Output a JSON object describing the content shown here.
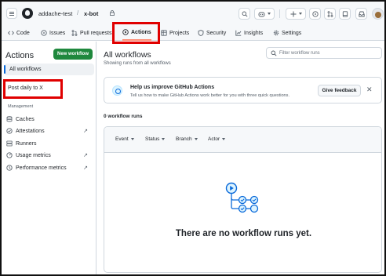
{
  "header": {
    "owner": "addache-test",
    "separator": "/",
    "repo": "x-bot"
  },
  "tabs": [
    {
      "label": "Code",
      "icon": "code-icon"
    },
    {
      "label": "Issues",
      "icon": "issue-icon"
    },
    {
      "label": "Pull requests",
      "icon": "pull-request-icon"
    },
    {
      "label": "Actions",
      "icon": "play-icon",
      "active": true
    },
    {
      "label": "Projects",
      "icon": "table-icon"
    },
    {
      "label": "Security",
      "icon": "shield-icon"
    },
    {
      "label": "Insights",
      "icon": "graph-icon"
    },
    {
      "label": "Settings",
      "icon": "gear-icon"
    }
  ],
  "sidebar": {
    "title": "Actions",
    "new_workflow": "New workflow",
    "all_workflows": "All workflows",
    "workflow": "Post daily to X",
    "management_heading": "Management",
    "items": [
      {
        "label": "Caches",
        "external": false
      },
      {
        "label": "Attestations",
        "external": true
      },
      {
        "label": "Runners",
        "external": false
      },
      {
        "label": "Usage metrics",
        "external": true
      },
      {
        "label": "Performance metrics",
        "external": true
      }
    ],
    "external_glyph": "↗"
  },
  "main": {
    "title": "All workflows",
    "subtitle": "Showing runs from all workflows",
    "filter_placeholder": "Filter workflow runs",
    "banner": {
      "title": "Help us improve GitHub Actions",
      "text": "Tell us how to make GitHub Actions work better for you with three quick questions.",
      "button": "Give feedback",
      "close": "✕"
    },
    "runs_count": "0 workflow runs",
    "filters": [
      "Event",
      "Status",
      "Branch",
      "Actor"
    ],
    "empty_text": "There are no workflow runs yet."
  },
  "colors": {
    "accent": "#0969da",
    "primary_button": "#1f883d",
    "active_tab_underline": "#fd8c73",
    "highlight_box": "#e00000"
  }
}
